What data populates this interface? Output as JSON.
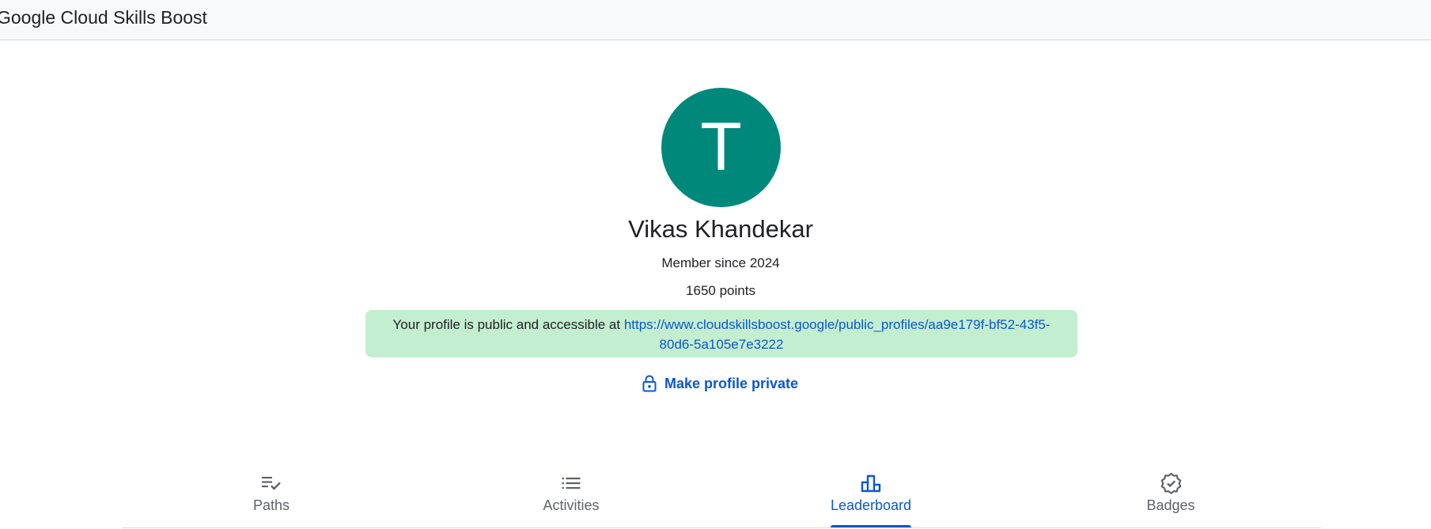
{
  "header": {
    "app_title": "Google Cloud Skills Boost"
  },
  "profile": {
    "avatar_initial": "T",
    "avatar_color": "#00897b",
    "name": "Vikas Khandekar",
    "member_since": "Member since 2024",
    "points": "1650 points"
  },
  "banner": {
    "text": "Your profile is public and accessible at ",
    "url": "https://www.cloudskillsboost.google/public_profiles/aa9e179f-bf52-43f5-80d6-5a105e7e3222",
    "background_color": "#c4eed0"
  },
  "privacy_action": {
    "label": "Make profile private",
    "icon": "lock-icon"
  },
  "tabs": [
    {
      "label": "Paths",
      "icon": "playlist-check-icon",
      "active": false
    },
    {
      "label": "Activities",
      "icon": "list-icon",
      "active": false
    },
    {
      "label": "Leaderboard",
      "icon": "leaderboard-icon",
      "active": true
    },
    {
      "label": "Badges",
      "icon": "verified-badge-icon",
      "active": false
    }
  ],
  "colors": {
    "accent": "#0b57d0",
    "inactive_tab": "#5f6368"
  }
}
